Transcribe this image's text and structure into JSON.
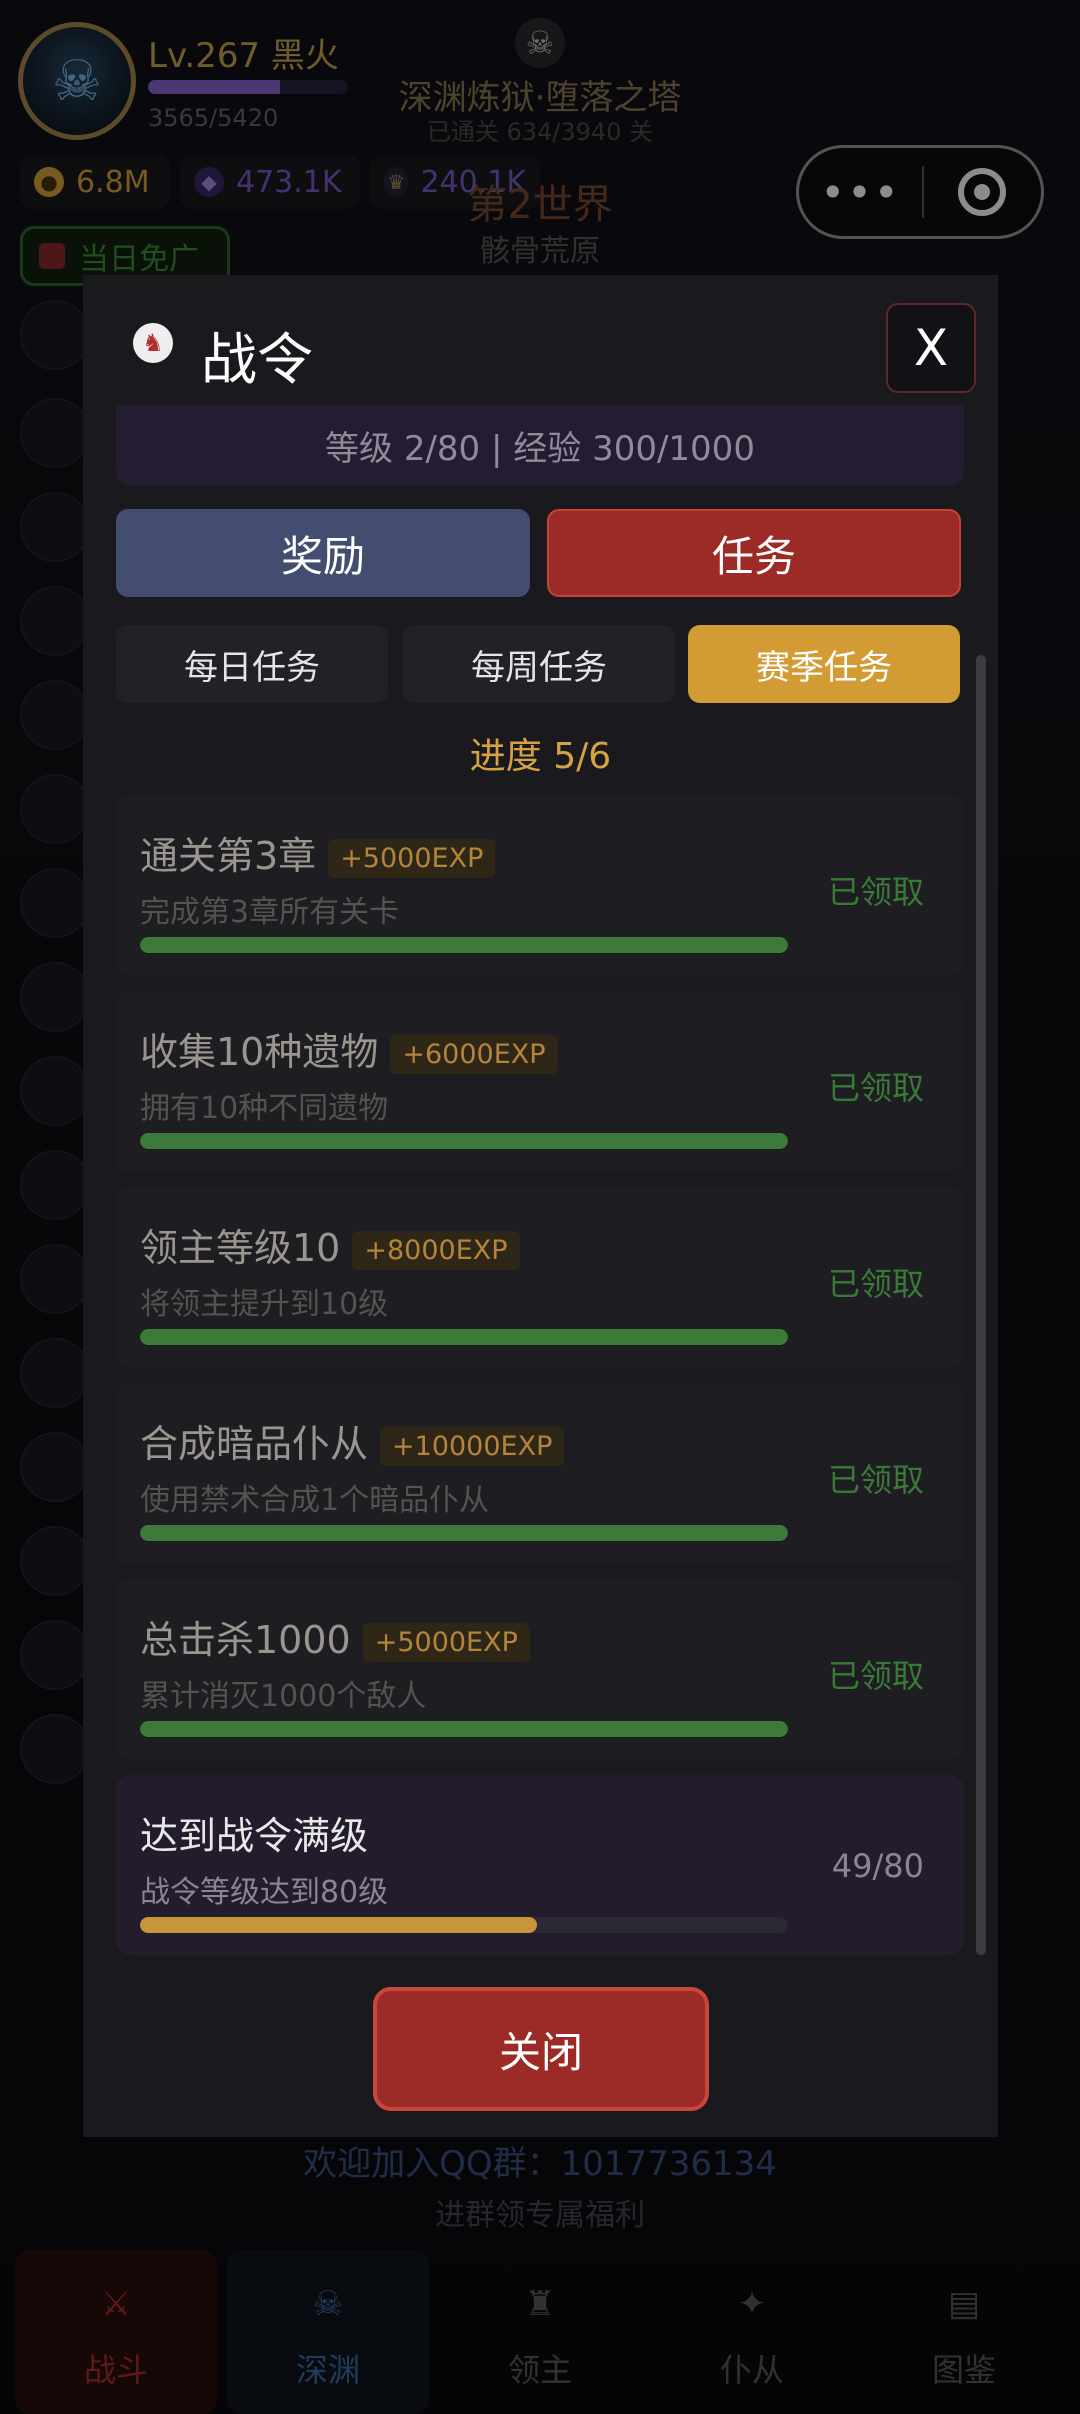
{
  "player": {
    "level_name": "Lv.267 黑火",
    "xp": "3565/5420",
    "xp_fraction": 0.66
  },
  "abyss": {
    "title": "深渊炼狱·堕落之塔",
    "subtitle": "已通关 634/3940 关"
  },
  "resources": [
    {
      "icon": "gold-coin-icon",
      "value": "6.8M",
      "color": "#d9a43a"
    },
    {
      "icon": "purple-gem-icon",
      "value": "473.1K",
      "color": "#7c5cc9"
    },
    {
      "icon": "crown-icon",
      "value": "240.1K",
      "color": "#7c5cc9"
    }
  ],
  "world": {
    "title": "第2世界",
    "subtitle": "骸骨荒原"
  },
  "free_ad": "当日免广",
  "capsule": {
    "menu_icon": "more-dots-icon",
    "close_icon": "target-circle-icon"
  },
  "modal": {
    "title": "战令",
    "close_x": "X",
    "level_line": "等级 2/80 | 经验 300/1000",
    "tabs": {
      "rewards": "奖励",
      "tasks": "任务"
    },
    "sub_tabs": {
      "daily": "每日任务",
      "weekly": "每周任务",
      "season": "赛季任务"
    },
    "progress": "进度 5/6",
    "tasks": [
      {
        "name": "通关第3章",
        "exp": "+5000EXP",
        "desc": "完成第3章所有关卡",
        "status": "已领取",
        "progress": 1.0,
        "bar_color": "#3d7a3a"
      },
      {
        "name": "收集10种遗物",
        "exp": "+6000EXP",
        "desc": "拥有10种不同遗物",
        "status": "已领取",
        "progress": 1.0,
        "bar_color": "#3d7a3a"
      },
      {
        "name": "领主等级10",
        "exp": "+8000EXP",
        "desc": "将领主提升到10级",
        "status": "已领取",
        "progress": 1.0,
        "bar_color": "#3d7a3a"
      },
      {
        "name": "合成暗品仆从",
        "exp": "+10000EXP",
        "desc": "使用禁术合成1个暗品仆从",
        "status": "已领取",
        "progress": 1.0,
        "bar_color": "#3d7a3a"
      },
      {
        "name": "总击杀1000",
        "exp": "+5000EXP",
        "desc": "累计消灭1000个敌人",
        "status": "已领取",
        "progress": 1.0,
        "bar_color": "#3d7a3a"
      },
      {
        "name": "达到战令满级",
        "exp": "",
        "desc": "战令等级达到80级",
        "status": "49/80",
        "progress": 0.6125,
        "bar_color": "#c8953a"
      }
    ],
    "close_button": "关闭"
  },
  "footer": {
    "qq_line": "欢迎加入QQ群：1017736134",
    "qq_sub": "进群领专属福利"
  },
  "bottom_nav": [
    {
      "label": "战斗",
      "icon": "crossed-swords-icon",
      "color": "#b02e2e",
      "bg": "#2a1010"
    },
    {
      "label": "深渊",
      "icon": "skull-icon",
      "color": "#3b6ba8",
      "bg": "#0f1620"
    },
    {
      "label": "领主",
      "icon": "lord-icon",
      "color": "#5a5a5a",
      "bg": "transparent"
    },
    {
      "label": "仆从",
      "icon": "summon-icon",
      "color": "#5a5a5a",
      "bg": "transparent"
    },
    {
      "label": "图鉴",
      "icon": "book-icon",
      "color": "#5a5a5a",
      "bg": "transparent"
    }
  ]
}
